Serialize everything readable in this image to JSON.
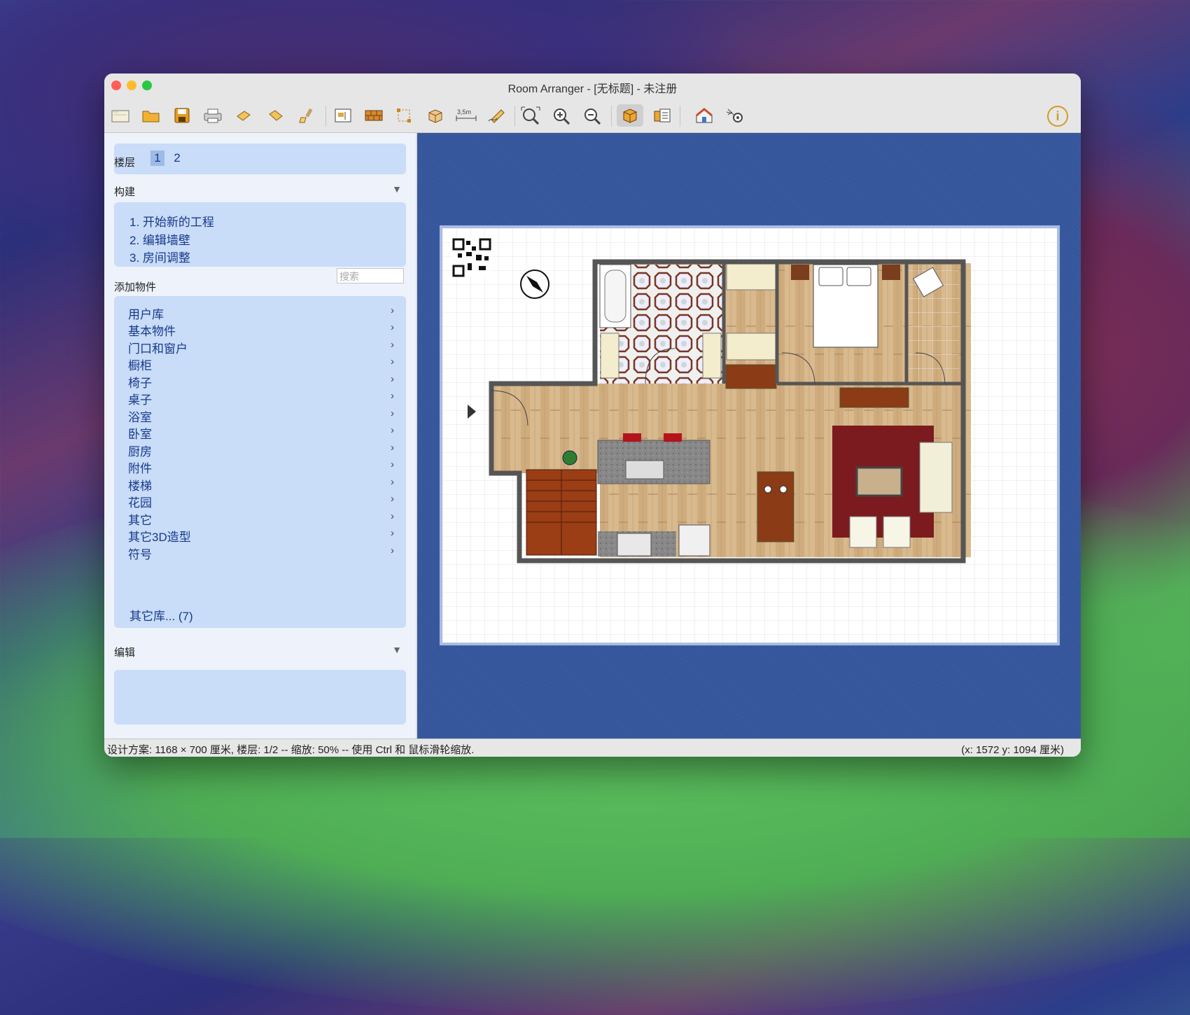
{
  "window": {
    "title": "Room Arranger - [无标题] - 未注册"
  },
  "floors": {
    "label": "楼层",
    "items": [
      "1",
      "2"
    ],
    "selected": "1"
  },
  "build": {
    "label": "构建",
    "steps": [
      "1. 开始新的工程",
      "2. 编辑墙壁",
      "3. 房间调整"
    ]
  },
  "add_objects": {
    "label": "添加物件",
    "search_placeholder": "搜索",
    "categories": [
      "用户库",
      "基本物件",
      "门口和窗户",
      "橱柜",
      "椅子",
      "桌子",
      "浴室",
      "卧室",
      "厨房",
      "附件",
      "楼梯",
      "花园",
      "其它",
      "其它3D造型",
      "符号"
    ],
    "other_libraries": "其它库... (7)"
  },
  "edit": {
    "label": "编辑"
  },
  "status": {
    "left": "设计方案: 1168 × 700 厘米, 楼层: 1/2 -- 缩放: 50% -- 使用 Ctrl 和 鼠标滑轮缩放.",
    "right": "(x: 1572 y: 1094 厘米)"
  },
  "toolbar": {
    "icons": [
      "new-plan-icon",
      "open-folder-icon",
      "save-icon",
      "print-icon",
      "undo-icon",
      "redo-icon",
      "paint-brush-icon",
      "room-settings-icon",
      "wall-brick-icon",
      "select-area-icon",
      "3d-box-move-icon",
      "measure-icon",
      "pencil-draw-icon",
      "zoom-fit-icon",
      "zoom-in-icon",
      "zoom-out-icon",
      "3d-view-icon",
      "object-list-icon",
      "house-icon",
      "settings-gear-icon"
    ],
    "measure_label": "3,5m"
  },
  "colors": {
    "accent": "#173a8a",
    "panel": "#c9dcf8",
    "canvas": "#35559b"
  }
}
